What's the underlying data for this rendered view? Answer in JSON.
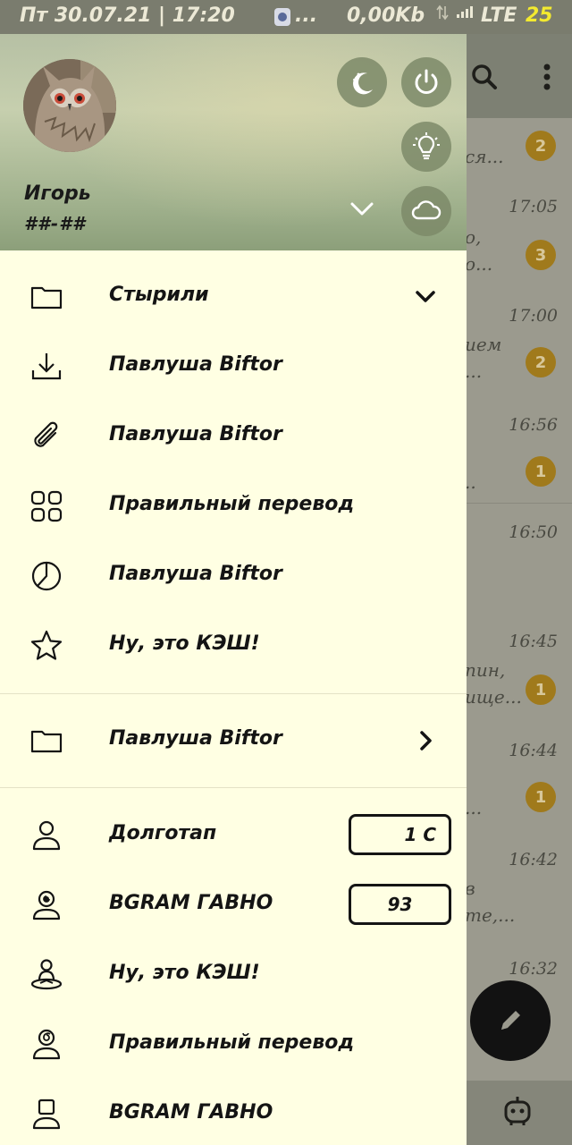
{
  "status_bar": {
    "datetime": "Пт 30.07.21  |  17:20",
    "more": "...",
    "speed": "0,00Kb",
    "network": "LTE",
    "battery": "25"
  },
  "background_chats": {
    "rows": [
      {
        "time": "",
        "snippet": "ся...",
        "badge": "2"
      },
      {
        "time": "17:05",
        "snippet": "о,\nо...",
        "badge": "3"
      },
      {
        "time": "17:00",
        "snippet": "ием\n...",
        "badge": "2"
      },
      {
        "time": "16:56",
        "snippet": "\n..",
        "badge": "1"
      },
      {
        "time": "16:50",
        "snippet": "",
        "badge": ""
      },
      {
        "time": "16:45",
        "snippet": "пин,\nище...",
        "badge": "1"
      },
      {
        "time": "16:44",
        "snippet": "\n...",
        "badge": "1"
      },
      {
        "time": "16:42",
        "snippet": "в\nте,...",
        "badge": ""
      },
      {
        "time": "16:32",
        "snippet": "",
        "badge": ""
      }
    ]
  },
  "drawer": {
    "user": {
      "name": "Игорь",
      "phone": "##-##"
    },
    "folders": [
      {
        "label": "Стырили",
        "icon": "folder-icon"
      },
      {
        "label": "Павлуша Biftor",
        "icon": "download-icon"
      },
      {
        "label": "Павлуша Biftor",
        "icon": "attachment-icon"
      },
      {
        "label": "Правильный перевод",
        "icon": "grid-icon"
      },
      {
        "label": "Павлуша Biftor",
        "icon": "pie-chart-icon"
      },
      {
        "label": "Ну, это КЭШ!",
        "icon": "star-icon"
      }
    ],
    "extra_folder": {
      "label": "Павлуша Biftor",
      "icon": "folder-icon"
    },
    "accounts": [
      {
        "label": "Долготап",
        "counter": "1 С"
      },
      {
        "label": "BGRAM ГАВНО",
        "counter": "93"
      },
      {
        "label": "Ну, это КЭШ!",
        "counter": ""
      },
      {
        "label": "Правильный перевод",
        "counter": ""
      },
      {
        "label": "BGRAM ГАВНО",
        "counter": ""
      }
    ]
  },
  "colors": {
    "drawer_bg": "#ffffe3",
    "accent_badge": "#a07a1c",
    "status_battery": "#f3ea2f"
  }
}
